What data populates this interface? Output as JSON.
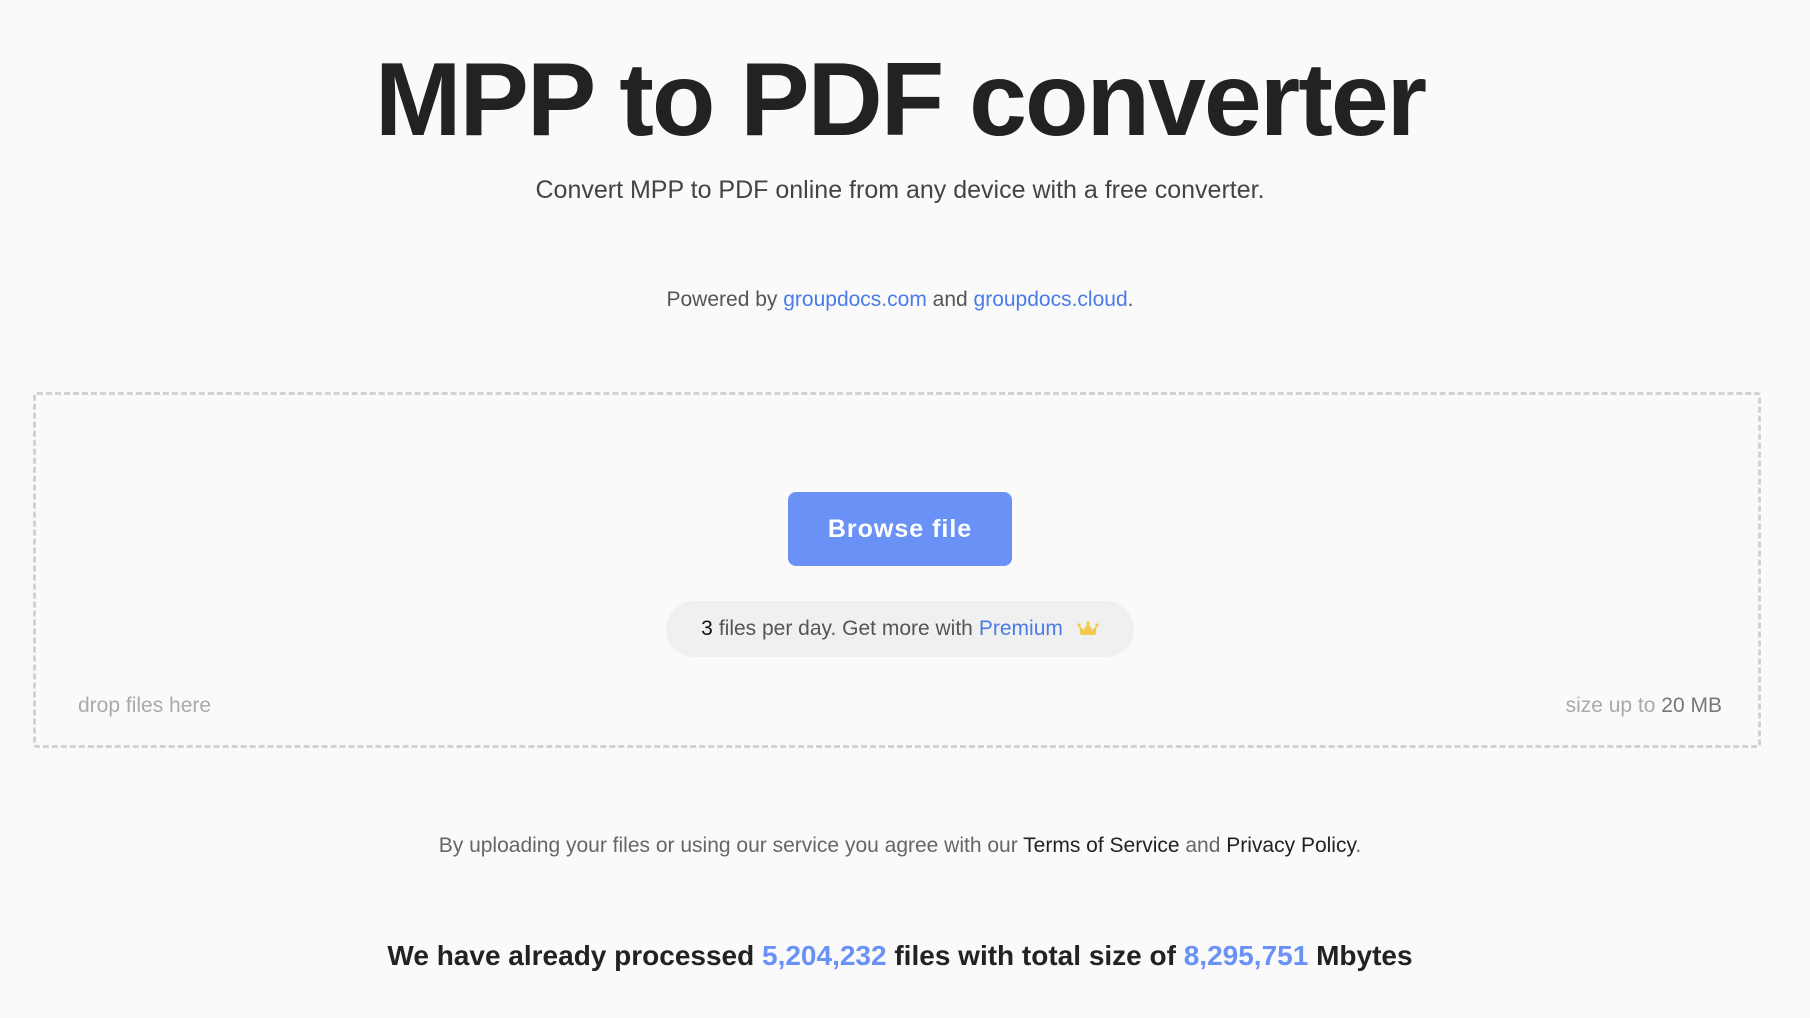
{
  "header": {
    "title": "MPP to PDF converter",
    "subtitle": "Convert MPP to PDF online from any device with a free converter."
  },
  "powered": {
    "prefix": "Powered by ",
    "link1": "groupdocs.com",
    "middle": " and ",
    "link2": "groupdocs.cloud",
    "suffix": "."
  },
  "dropzone": {
    "browse_label": "Browse file",
    "limit_count": "3",
    "limit_text": "files per day. Get more with",
    "premium_label": "Premium",
    "premium_icon": "crown-icon",
    "drop_hint": "drop files here",
    "size_prefix": "size up to ",
    "size_value": "20 MB"
  },
  "terms": {
    "prefix": "By uploading your files or using our service you agree with our ",
    "tos_label": "Terms of Service",
    "middle": " and ",
    "privacy_label": "Privacy Policy",
    "suffix": "."
  },
  "stats": {
    "prefix": "We have already processed ",
    "files_count": "5,204,232",
    "middle": " files with total size of ",
    "total_size": "8,295,751",
    "suffix": " Mbytes"
  },
  "colors": {
    "accent": "#6a92f6",
    "link": "#4a7be6",
    "crown": "#f2c94c"
  }
}
